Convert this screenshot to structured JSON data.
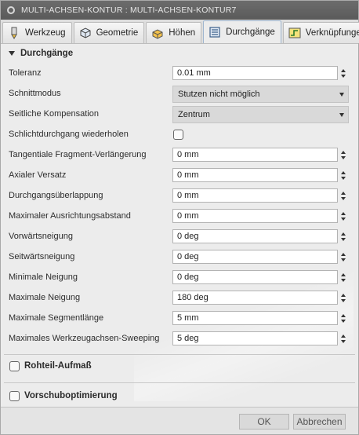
{
  "window": {
    "title": "MULTI-ACHSEN-KONTUR : MULTI-ACHSEN-KONTUR7"
  },
  "tabs": [
    {
      "label": "Werkzeug",
      "icon": "tool-icon"
    },
    {
      "label": "Geometrie",
      "icon": "geometry-icon"
    },
    {
      "label": "Höhen",
      "icon": "heights-icon"
    },
    {
      "label": "Durchgänge",
      "icon": "passes-icon",
      "active": true
    },
    {
      "label": "Verknüpfungen",
      "icon": "linking-icon"
    }
  ],
  "section": {
    "title": "Durchgänge"
  },
  "fields": {
    "toleranz": {
      "label": "Toleranz",
      "value": "0.01 mm"
    },
    "schnittmodus": {
      "label": "Schnittmodus",
      "value": "Stutzen nicht möglich"
    },
    "seitliche_kompensation": {
      "label": "Seitliche Kompensation",
      "value": "Zentrum"
    },
    "schlichtdurchgang": {
      "label": "Schlichtdurchgang wiederholen",
      "checked": false
    },
    "tangentiale": {
      "label": "Tangentiale Fragment-Verlängerung",
      "value": "0 mm"
    },
    "axialer_versatz": {
      "label": "Axialer Versatz",
      "value": "0 mm"
    },
    "durchgangsueberlappung": {
      "label": "Durchgangsüberlappung",
      "value": "0 mm"
    },
    "max_ausrichtungsabstand": {
      "label": "Maximaler Ausrichtungsabstand",
      "value": "0 mm"
    },
    "vorwaertsneigung": {
      "label": "Vorwärtsneigung",
      "value": "0 deg"
    },
    "seitwaertsneigung": {
      "label": "Seitwärtsneigung",
      "value": "0 deg"
    },
    "minimale_neigung": {
      "label": "Minimale Neigung",
      "value": "0 deg"
    },
    "maximale_neigung": {
      "label": "Maximale Neigung",
      "value": "180 deg"
    },
    "max_segmentlaenge": {
      "label": "Maximale Segmentlänge",
      "value": "5 mm"
    },
    "max_sweeping": {
      "label": "Maximales Werkzeugachsen-Sweeping",
      "value": "5 deg"
    }
  },
  "collapsed_sections": {
    "rohteil": {
      "label": "Rohteil-Aufmaß",
      "checked": false
    },
    "vorschub": {
      "label": "Vorschuboptimierung",
      "checked": false
    }
  },
  "buttons": {
    "ok": "OK",
    "cancel": "Abbrechen"
  }
}
